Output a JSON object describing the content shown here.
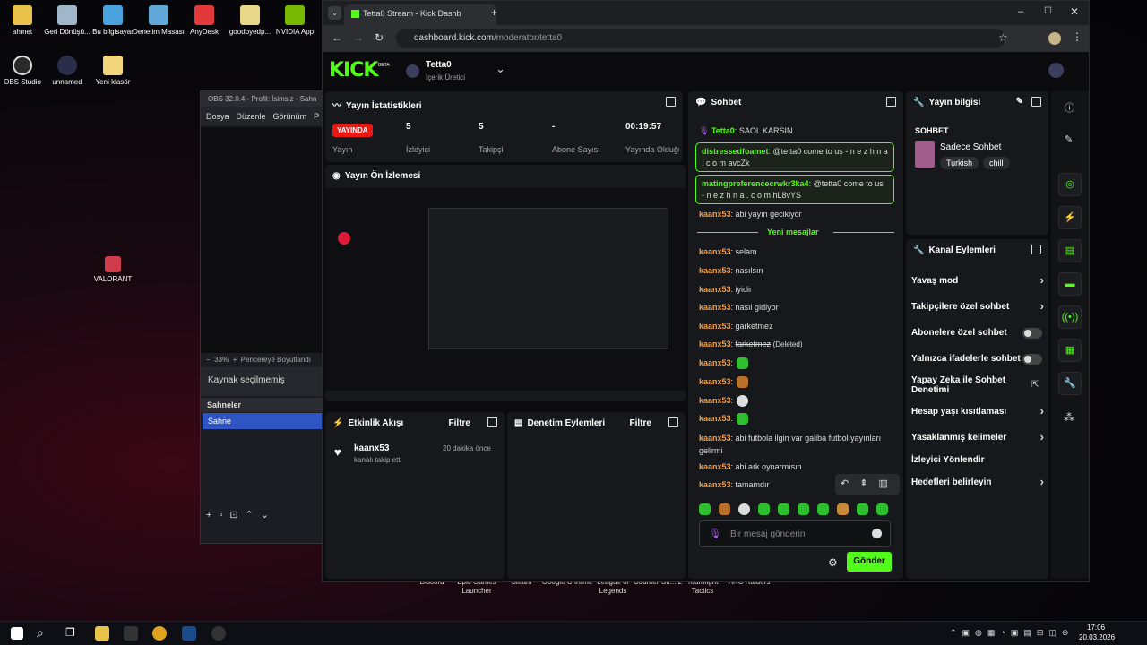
{
  "desktop": {
    "icons": [
      "ahmet",
      "Geri Dönüşü...",
      "Bu bilgisayar",
      "Denetim Masası",
      "AnyDesk",
      "goodbyedp...",
      "NVIDIA App",
      "OBS Studio",
      "unnamed",
      "Yeni klasör",
      "VALORANT"
    ],
    "bottom_icons": [
      "Discord",
      "Epic Games Launcher",
      "Steam",
      "Google Chrome",
      "League of Legends",
      "Counter-Str... 2",
      "Teamfight Tactics",
      "ARC Raiders"
    ]
  },
  "obs": {
    "title": "OBS 32.0.4 - Profil: İsimsiz - Sahn",
    "menu": [
      "Dosya",
      "Düzenle",
      "Görünüm",
      "P"
    ],
    "zoom": "33%",
    "fit_label": "Pencereye Boyutlandı",
    "no_source": "Kaynak seçilmemiş",
    "scenes_label": "Sahneler",
    "scene_item": "Sahne"
  },
  "browser": {
    "tab_title": "Tetta0 Stream - Kick Dashb",
    "url_domain": "dashboard.kick.com",
    "url_path": "/moderator/tetta0"
  },
  "kick": {
    "logo": "KICK",
    "beta": "BETA",
    "channel_name": "Tetta0",
    "channel_role": "İçerik Üretici",
    "stats": {
      "title": "Yayın İstatistikleri",
      "live_badge": "YAYINDA",
      "live_label": "Yayın",
      "viewers": "5",
      "viewers_label": "İzleyici",
      "followers": "5",
      "followers_label": "Takipçi",
      "subs": "-",
      "subs_label": "Abone Sayısı",
      "duration": "00:19:57",
      "duration_label": "Yayında Olduğu Süre"
    },
    "preview_title": "Yayın Ön İzlemesi",
    "activity": {
      "title": "Etkinlik Akışı",
      "filter": "Filtre",
      "user": "kaanx53",
      "text": "kanalı takip etti",
      "time": "20 dakika önce"
    },
    "mod_actions": {
      "title": "Denetim Eylemleri",
      "filter": "Filtre"
    },
    "chat": {
      "title": "Sohbet",
      "new_messages": "Yeni mesajlar",
      "input_placeholder": "Bir mesaj gönderin",
      "send": "Gönder",
      "top_msg": {
        "user": "Tetta0",
        "text": "SAOL KARSIN"
      },
      "highlight1": {
        "user": "distressedfoamet",
        "text": "@tetta0 come to us - n e z h n a . c o m avcZk"
      },
      "highlight2": {
        "user": "matingpreferencecrwkr3ka4",
        "text": "@tetta0 come to us - n e z h n a . c o m hL8vYS"
      },
      "pre_new": {
        "user": "kaanx53",
        "text": "abi yayın gecikiyor"
      },
      "messages": [
        {
          "user": "kaanx53",
          "text": "selam"
        },
        {
          "user": "kaanx53",
          "text": "nasılsın"
        },
        {
          "user": "kaanx53",
          "text": "iyidir"
        },
        {
          "user": "kaanx53",
          "text": "nasıl gidiyor"
        },
        {
          "user": "kaanx53",
          "text": "garketmez"
        },
        {
          "user": "kaanx53",
          "text": "farketmez",
          "deleted": "(Deleted)"
        },
        {
          "user": "kaanx53",
          "text": ""
        },
        {
          "user": "kaanx53",
          "text": ""
        },
        {
          "user": "kaanx53",
          "text": ""
        },
        {
          "user": "kaanx53",
          "text": ""
        },
        {
          "user": "kaanx53",
          "text": "abi futbola ilgin var galiba futbol yayınları gelirmi"
        },
        {
          "user": "kaanx53",
          "text": "abi ark oynarmısın"
        },
        {
          "user": "kaanx53",
          "text": "tamamdır"
        }
      ]
    },
    "stream_info": {
      "title": "Yayın bilgisi",
      "section": "SOHBET",
      "category": "Sadece Sohbet",
      "tags": [
        "Turkish",
        "chill"
      ]
    },
    "channel_actions": {
      "title": "Kanal Eylemleri",
      "items": [
        "Yavaş mod",
        "Takipçilere özel sohbet",
        "Abonelere özel sohbet",
        "Yalnızca ifadelerle sohbet",
        "Yapay Zeka ile Sohbet Denetimi",
        "Hesap yaşı kısıtlaması",
        "Yasaklanmış kelimeler",
        "İzleyici Yönlendir",
        "Hedefleri belirleyin"
      ]
    }
  },
  "taskbar": {
    "time": "17:06",
    "date": "20.03.2026"
  },
  "colors": {
    "kick_green": "#53fc18",
    "live_red": "#e91916",
    "username_orange": "#f4a04a"
  }
}
